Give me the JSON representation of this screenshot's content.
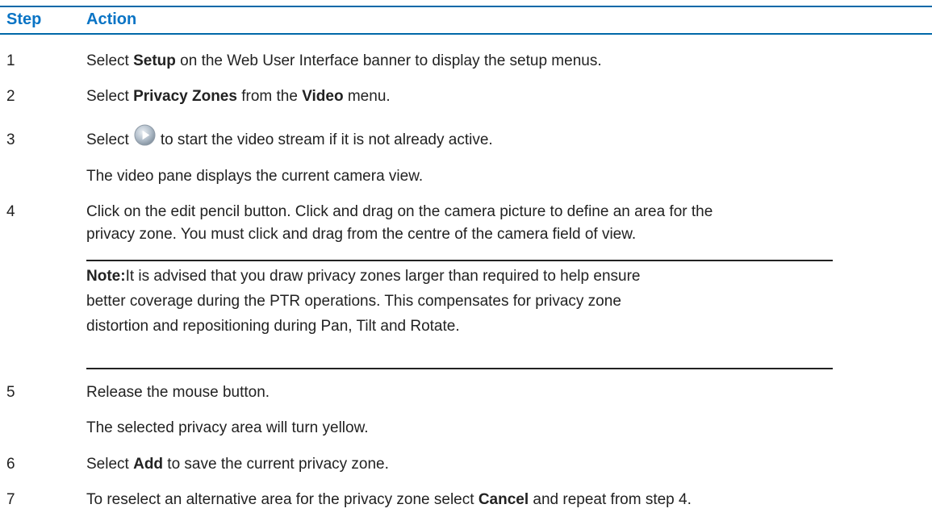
{
  "header": {
    "step_label": "Step",
    "action_label": "Action"
  },
  "steps": [
    {
      "num": "1",
      "lines": [
        {
          "pre": "Select ",
          "bold": "Setup",
          "post": " on the Web User Interface banner to display the setup menus."
        }
      ]
    },
    {
      "num": "2",
      "lines": [
        {
          "pre": "Select ",
          "bold": "Privacy Zones",
          "mid": " from the ",
          "bold2": "Video",
          "post": " menu."
        }
      ]
    },
    {
      "num": "3",
      "lines": [
        {
          "pre": "Select",
          "icon": "play-button-icon",
          "post": "to start the video stream if it is not already active."
        },
        {
          "pre": "The video pane displays the current camera view."
        }
      ]
    },
    {
      "num": "4",
      "lines": [
        {
          "pre": "Click on the edit pencil button. Click and drag on the camera picture to define an area for the"
        },
        {
          "pre": "privacy zone. You must click and drag from the centre of the camera field of view."
        }
      ]
    },
    {
      "num": "5",
      "lines": [
        {
          "pre": "Release the mouse button."
        },
        {
          "pre": "The selected privacy area will turn yellow."
        }
      ]
    },
    {
      "num": "6",
      "lines": [
        {
          "pre": "Select ",
          "bold": "Add",
          "post": " to save the current privacy zone."
        }
      ]
    },
    {
      "num": "7",
      "lines": [
        {
          "pre": "To reselect an alternative area for the privacy zone select ",
          "bold": "Cancel",
          "post": " and repeat from step 4."
        }
      ]
    }
  ],
  "note": {
    "label": "Note:",
    "line1": "It is advised that you draw privacy zones larger than required to help ensure",
    "line2": "better coverage during the PTR operations. This compensates for privacy zone",
    "line3": "distortion and repositioning during Pan, Tilt and Rotate."
  },
  "colors": {
    "header_text": "#0a74c5",
    "header_rule": "#0068a8",
    "body_text": "#222222"
  }
}
